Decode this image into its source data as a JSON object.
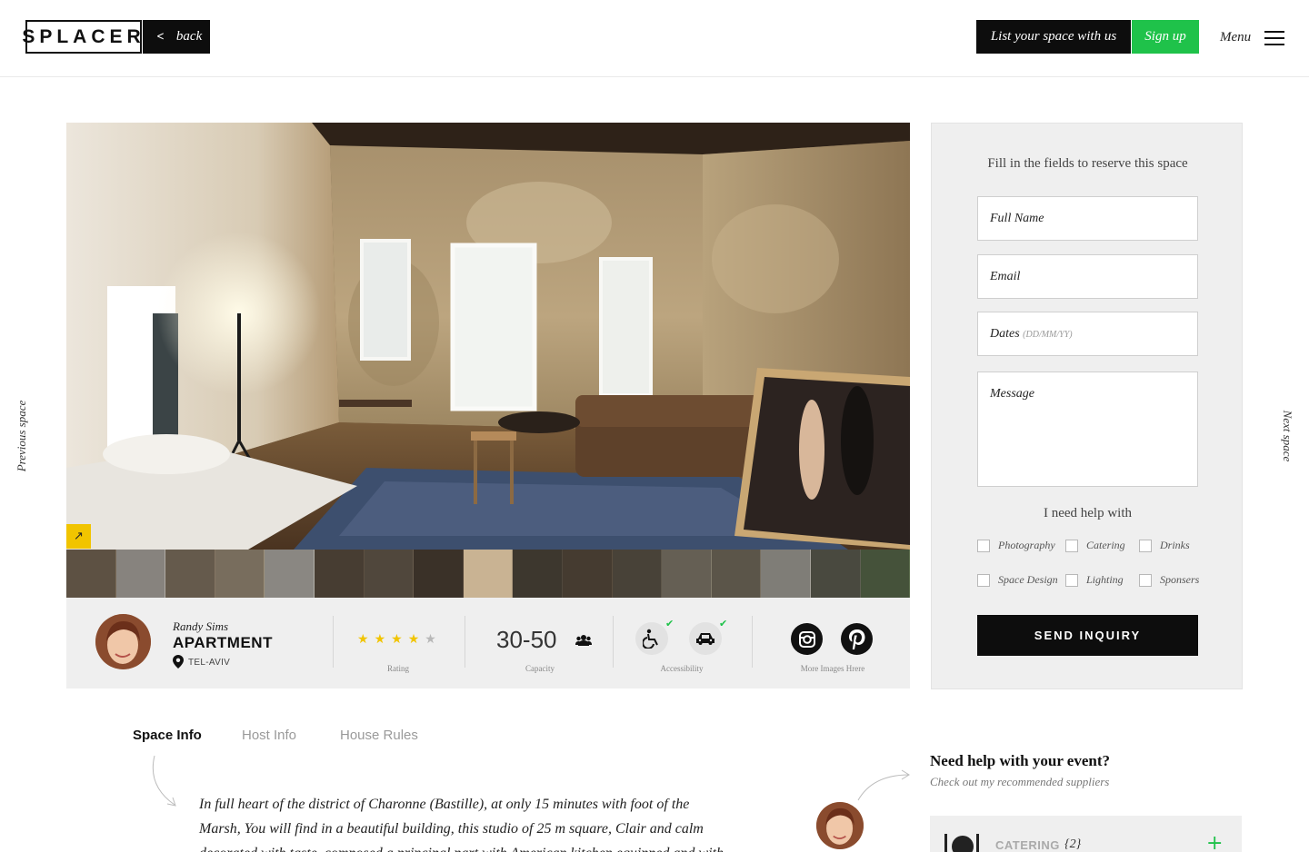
{
  "header": {
    "logo": "SPLACER",
    "back_label": "back",
    "list_label": "List your space with us",
    "signup_label": "Sign up",
    "menu_label": "Menu"
  },
  "side_nav": {
    "previous": "Previous space",
    "next": "Next space"
  },
  "space": {
    "host_name": "Randy Sims",
    "type": "APARTMENT",
    "location": "TEL-AVIV",
    "rating": 4,
    "rating_max": 5,
    "rating_label": "Rating",
    "capacity": "30-50",
    "capacity_label": "Capacity",
    "accessibility_label": "Accessibility",
    "more_images_label": "More Images Hrere",
    "thumbnail_count": 17,
    "active_thumbnail": 8
  },
  "reserve": {
    "title": "Fill in the fields to reserve this space",
    "full_name_placeholder": "Full Name",
    "email_placeholder": "Email",
    "dates_placeholder": "Dates",
    "dates_hint": "(DD/MM/YY)",
    "message_placeholder": "Message",
    "help_title": "I need help with",
    "options": [
      "Photography",
      "Catering",
      "Drinks",
      "Space Design",
      "Lighting",
      "Sponsers"
    ],
    "send_label": "SEND INQUIRY"
  },
  "tabs": [
    "Space Info",
    "Host Info",
    "House Rules"
  ],
  "description": "In full heart of the district of Charonne (Bastille), at only 15 minutes with foot of the Marsh, You will find in a beautiful building, this studio of 25 m square, Clair and calm decorated with taste, composed a principal part with American kitchen equipped and with",
  "suppliers": {
    "heading": "Need help with your event?",
    "sub": "Check out my recommended suppliers",
    "category_label": "CATERING",
    "category_count": "{2}"
  },
  "colors": {
    "accent_green": "#1fc24a",
    "accent_yellow": "#f1c400",
    "dark": "#0d0d0d",
    "panel_gray": "#efefef"
  }
}
